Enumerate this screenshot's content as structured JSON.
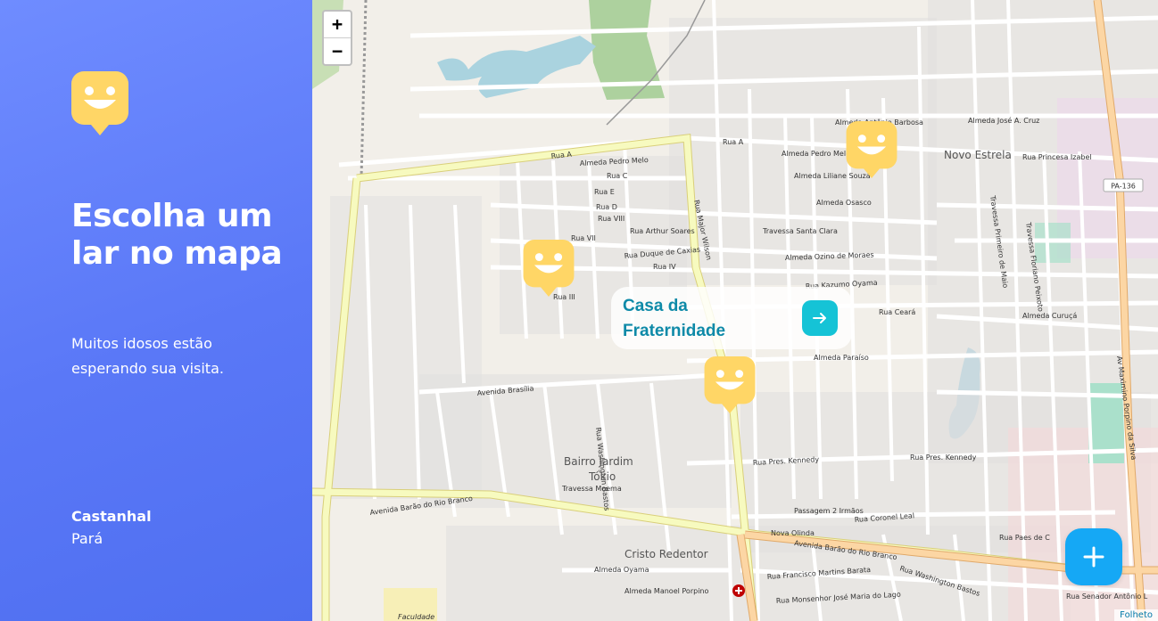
{
  "sidebar": {
    "title": "Escolha um lar no mapa",
    "subtitle": "Muitos idosos estão esperando sua visita.",
    "city": "Castanhal",
    "state": "Pará"
  },
  "map": {
    "zoom_in": "+",
    "zoom_out": "−",
    "attribution": "Folheto",
    "areas": {
      "novo_estrela": "Novo Estrela",
      "bairro_jardim_1": "Bairro Jardim",
      "bairro_jardim_2": "Tókio",
      "cristo_redentor": "Cristo Redentor",
      "pa136": "PA-136",
      "faculdade": "Faculdade"
    },
    "streets": {
      "rua_a": "Rua A",
      "rua_a2": "Rua A",
      "av_barao_1": "Avenida Barão do Rio Branco",
      "av_barao_2": "Avenida Barão do Rio Branco",
      "av_brasilia": "Avenida Brasília",
      "rua_major_wilson": "Rua Major Wilson",
      "rua_kazumo": "Rua Kazumo Oyama",
      "rua_princesa": "Rua Princesa Izabel",
      "alm_pedro_melo": "Almeda Pedro Melo",
      "alm_pedro_melo2": "Almeda Pedro Melo",
      "alm_antonio": "Almeda Antônio Barbosa",
      "alm_liliane": "Almeda Liliane Souza",
      "alm_osasco": "Almeda Osasco",
      "alm_ozino": "Almeda Ozino de Moraes",
      "trav_santa_clara": "Travessa Santa Clara",
      "rua_ceara": "Rua Ceará",
      "alm_curuca": "Almeda Curuçá",
      "alm_paraiso": "Almeda Paraíso",
      "rua_pres_kennedy": "Rua Pres. Kennedy",
      "rua_pres_kennedy2": "Rua Pres. Kennedy",
      "passagem_irmaos": "Passagem 2 Irmãos",
      "rua_coronel_leal": "Rua Coronel Leal",
      "nova_olinda": "Nova Olinda",
      "alm_oyama": "Almeda Oyama",
      "alm_manoel": "Almeda Manoel Porpino",
      "trav_moema": "Travessa Moema",
      "rua_duque": "Rua Duque de Caxias",
      "rua_arthur": "Rua Arthur Soares",
      "rua_c": "Rua C",
      "rua_e": "Rua E",
      "rua_d": "Rua D",
      "rua_viii": "Rua VIII",
      "rua_vii": "Rua VII",
      "rua_iv": "Rua IV",
      "rua_iii": "Rua III",
      "rua_francisco": "Rua Francisco Martins Barata",
      "rua_monsenhor": "Rua Monsenhor José Maria do Lago",
      "rua_paes": "Rua Paes de C",
      "rua_senador": "Rua Senador Antônio L",
      "alm_jose": "Almeda José A. Cruz",
      "av_maximino": "Av Maximino Porpino da Silva",
      "rua_washington": "Rua Washington Bastos",
      "trav_floriano": "Travessa Floriano Peixoto",
      "trav_primeiro": "Travessa Primeiro de Maio"
    }
  },
  "popup": {
    "name": "Casa da Fraternidade"
  },
  "colors": {
    "sidebar_top": "#6f8cff",
    "sidebar_bottom": "#4f6ff0",
    "marker": "#ffd666",
    "popup_text": "#0e8aa8",
    "popup_button": "#15c3d6",
    "fab": "#15a8f5"
  }
}
